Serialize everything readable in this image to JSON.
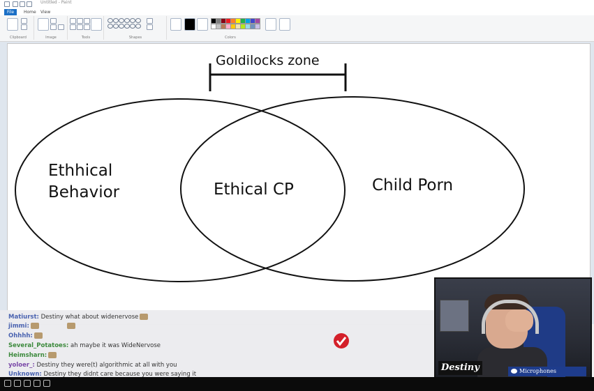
{
  "window": {
    "title": "Untitled - Paint"
  },
  "tabs": [
    {
      "label": "File",
      "active": true
    },
    {
      "label": "Home",
      "active": false
    },
    {
      "label": "View",
      "active": false
    }
  ],
  "ribbon": {
    "groups": [
      {
        "label": "Clipboard"
      },
      {
        "label": "Image"
      },
      {
        "label": "Tools"
      },
      {
        "label": "Shapes"
      },
      {
        "label": "Colors"
      }
    ],
    "buttons": {
      "paste": "Paste",
      "select": "Select",
      "brushes": "Brushes",
      "size": "Size",
      "color1": "Color 1",
      "color2": "Color 2",
      "edit_colors": "Edit colors",
      "edit_with_paint3d": "Edit with Paint 3D"
    },
    "palette": [
      "#000000",
      "#7f7f7f",
      "#880015",
      "#ed1c24",
      "#ff7f27",
      "#fff200",
      "#22b14c",
      "#00a2e8",
      "#3f48cc",
      "#a349a4",
      "#ffffff",
      "#c3c3c3",
      "#b97a57",
      "#ffaec9",
      "#ffc90e",
      "#efe4b0",
      "#b5e61d",
      "#99d9ea",
      "#7092be",
      "#c8bfe7"
    ]
  },
  "canvas": {
    "goldilocks_label": "Goldilocks zone",
    "left_label_line1": "Ethhical",
    "left_label_line2": "Behavior",
    "center_label": "Ethical CP",
    "right_label": "Child Porn"
  },
  "chat": [
    {
      "user": "Matiurst:",
      "text": " Destiny what about widenervose",
      "emote": true
    },
    {
      "user": "jimmi:",
      "text": "",
      "emote": true
    },
    {
      "user": "Ohhhh:",
      "text": "",
      "emote": true
    },
    {
      "user": "Several_Potatoes:",
      "text": " ah maybe it was WideNervose"
    },
    {
      "user": "Heimsharn:",
      "text": "",
      "emote": true
    },
    {
      "user": "yoloer_:",
      "text": " Destiny they were(t) algorithmic at all with you"
    },
    {
      "user": "Unknown:",
      "text": " Destiny they didnt care because you were saying it"
    }
  ],
  "webcam": {
    "logo_text": "Destiny",
    "mic_label": "Microphones"
  },
  "colors": {
    "accent": "#1a6fc6",
    "canvas_bg": "#ffffff",
    "stroke": "#111111"
  }
}
